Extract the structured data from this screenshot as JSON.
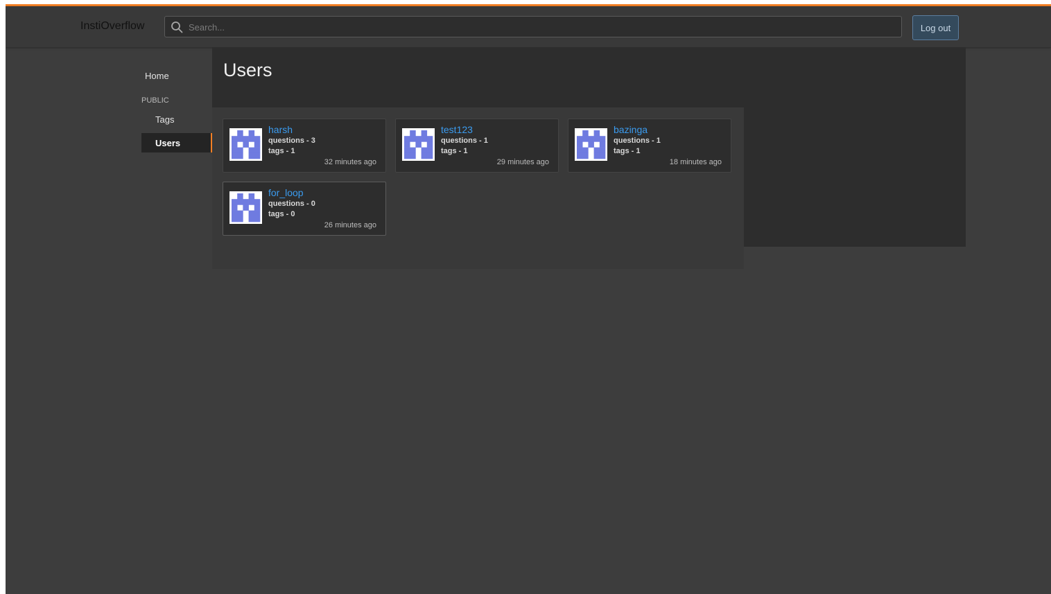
{
  "app": {
    "title": "InstiOverflow",
    "accent_color": "#f48024",
    "link_color": "#3b9cf0"
  },
  "search": {
    "placeholder": "Search...",
    "value": "",
    "icon": "search-icon"
  },
  "header": {
    "logout_label": "Log out"
  },
  "sidebar": {
    "home_label": "Home",
    "section_label": "PUBLIC",
    "tags_label": "Tags",
    "users_label": "Users",
    "active": "Users"
  },
  "main": {
    "title": "Users"
  },
  "users": [
    {
      "name": "harsh",
      "questions": "questions - 3",
      "tags": "tags - 1",
      "time": "32 minutes ago"
    },
    {
      "name": "test123",
      "questions": "questions - 1",
      "tags": "tags - 1",
      "time": "29 minutes ago"
    },
    {
      "name": "bazinga",
      "questions": "questions - 1",
      "tags": "tags - 1",
      "time": "18 minutes ago"
    },
    {
      "name": "for_loop",
      "questions": "questions - 0",
      "tags": "tags - 0",
      "time": "26 minutes ago"
    }
  ]
}
